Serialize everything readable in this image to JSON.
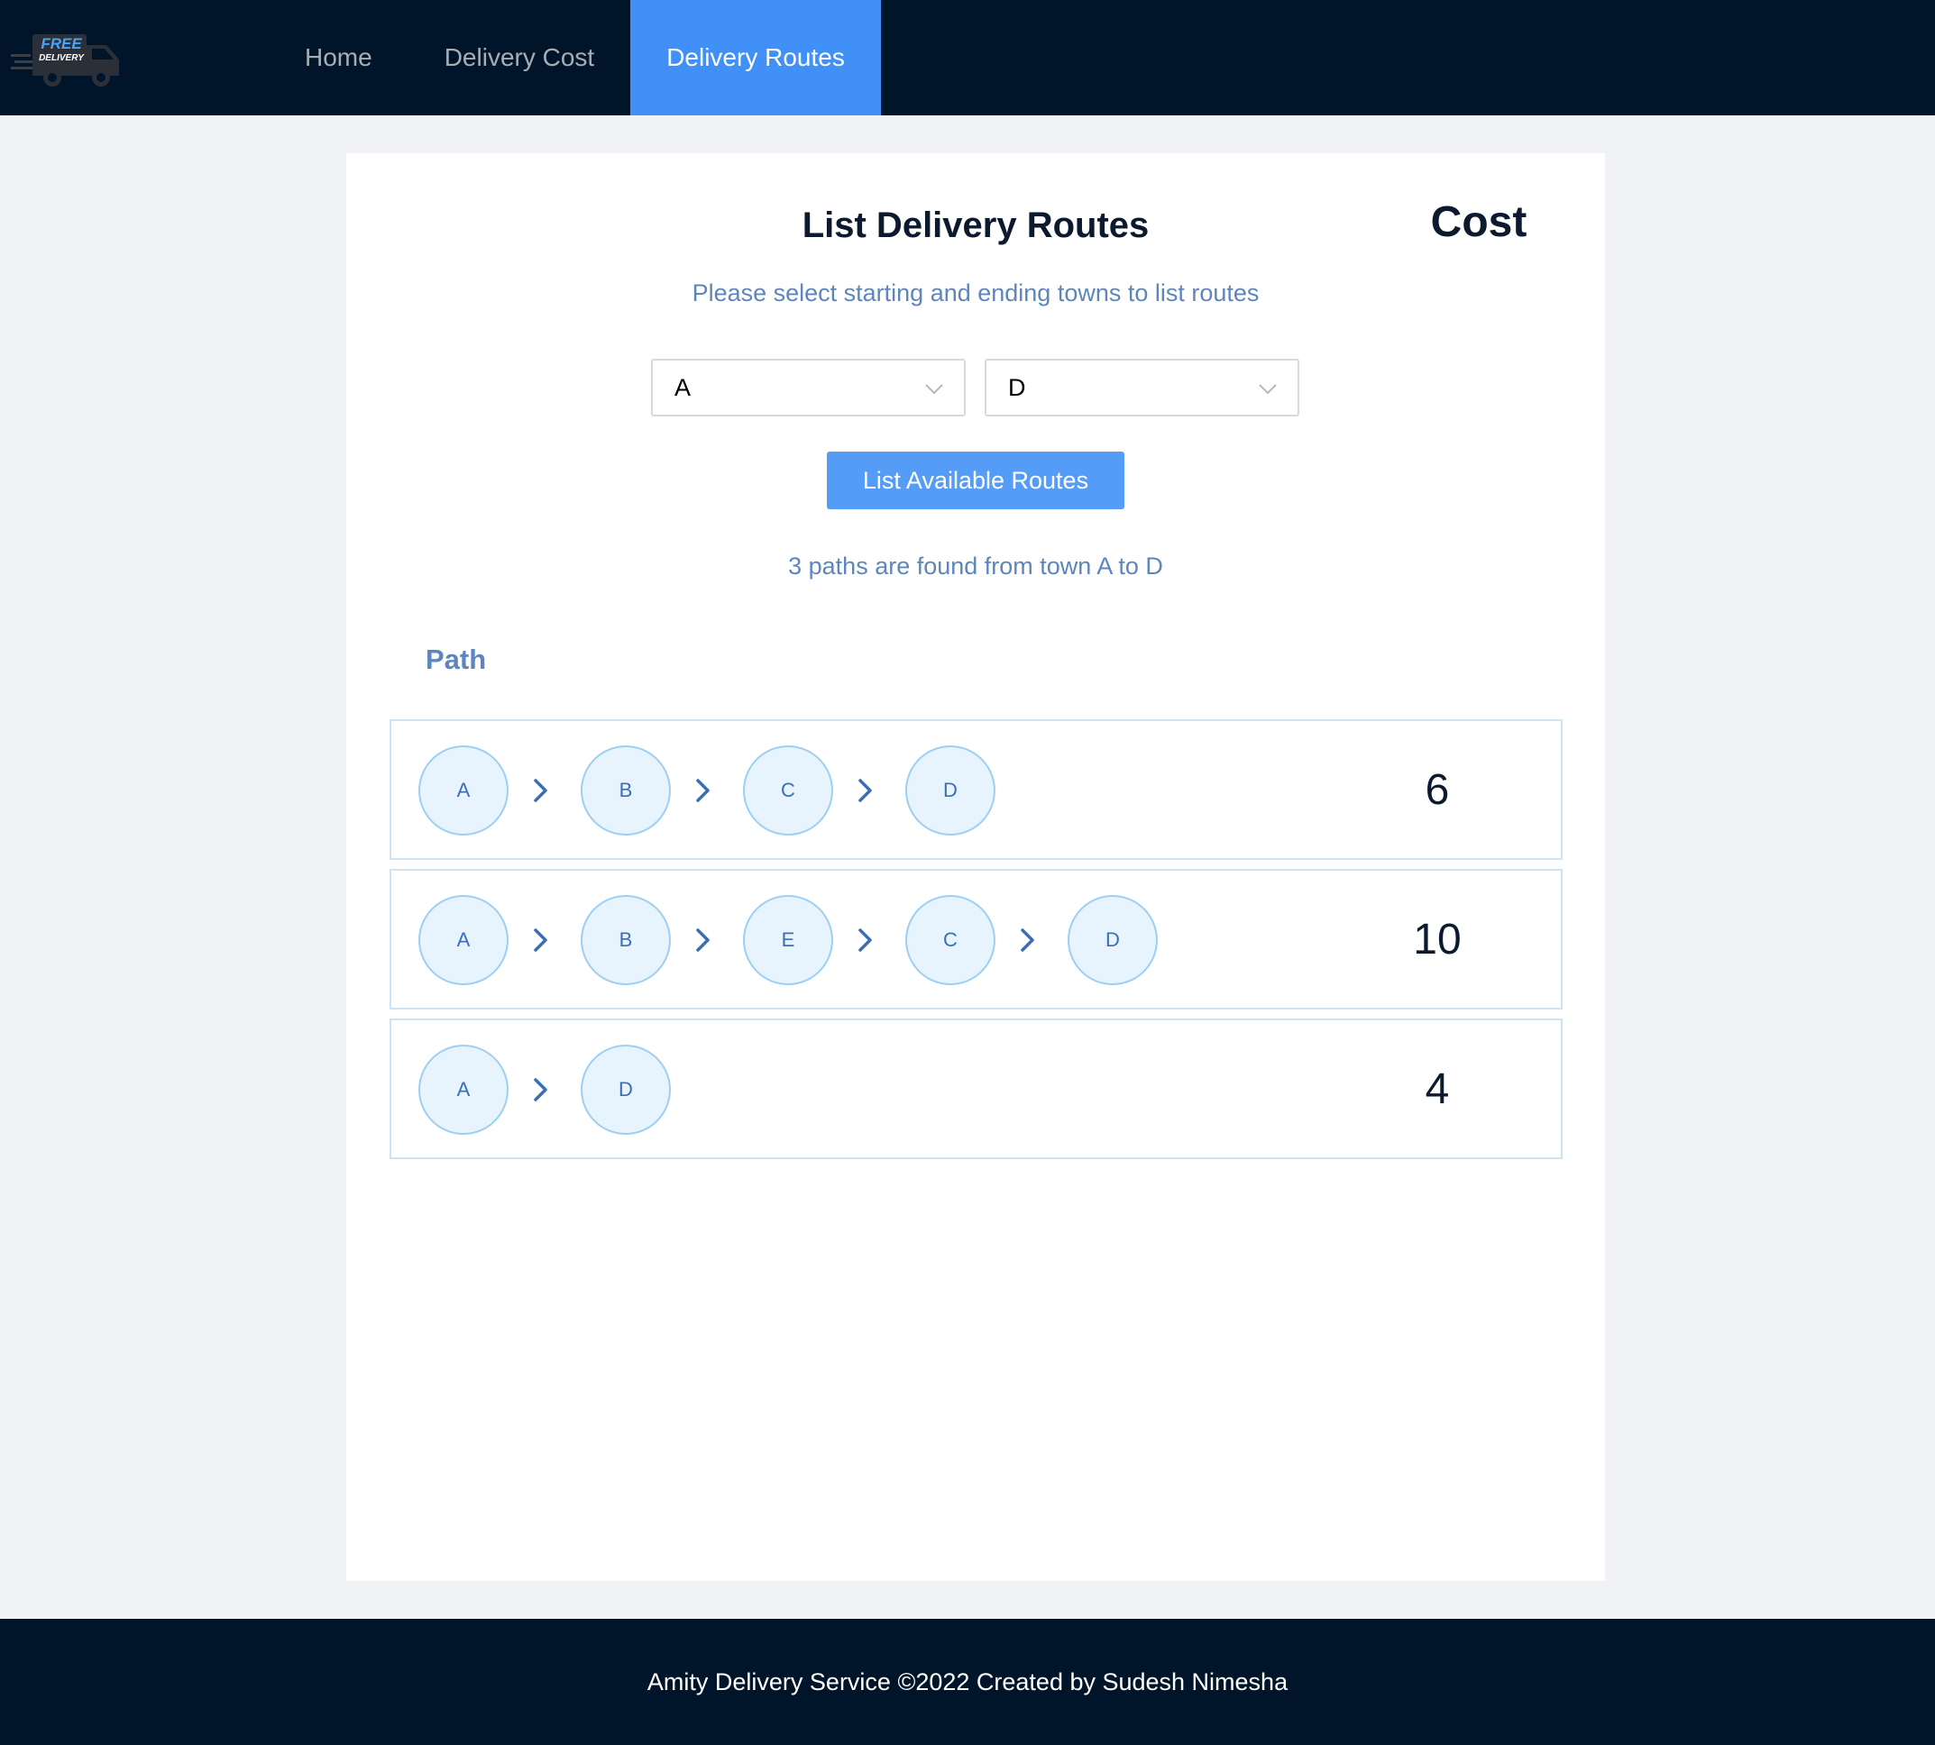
{
  "header": {
    "logo_text_top": "FREE",
    "logo_text_bottom": "DELIVERY",
    "nav": [
      {
        "label": "Home",
        "active": false
      },
      {
        "label": "Delivery Cost",
        "active": false
      },
      {
        "label": "Delivery Routes",
        "active": true
      }
    ]
  },
  "main": {
    "title": "List Delivery Routes",
    "subtitle": "Please select starting and ending towns to list routes",
    "start_town": "A",
    "end_town": "D",
    "button_label": "List Available Routes",
    "result_text": "3 paths are found from town A to D",
    "columns": {
      "path": "Path",
      "cost": "Cost"
    },
    "routes": [
      {
        "path": [
          "A",
          "B",
          "C",
          "D"
        ],
        "cost": "6"
      },
      {
        "path": [
          "A",
          "B",
          "E",
          "C",
          "D"
        ],
        "cost": "10"
      },
      {
        "path": [
          "A",
          "D"
        ],
        "cost": "4"
      }
    ]
  },
  "footer": {
    "text": "Amity Delivery Service ©2022 Created by Sudesh Nimesha"
  },
  "colors": {
    "header_bg": "#001529",
    "active_nav": "#4090f7",
    "button": "#559cf6",
    "accent_text": "#5d86bd",
    "node_fill": "#e7f3fd",
    "node_border": "#9dcff3"
  }
}
